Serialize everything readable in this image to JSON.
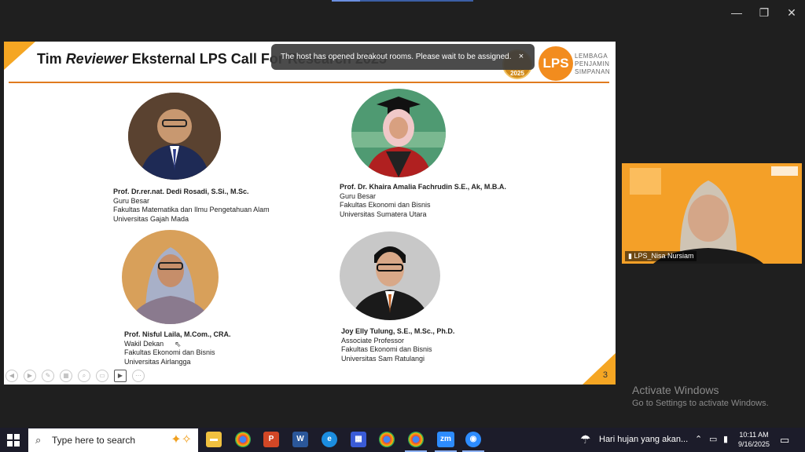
{
  "slide": {
    "title_pre": "Tim ",
    "title_italic": "Reviewer",
    "title_post": " Eksternal LPS Call For Research 2025",
    "page_number": "3",
    "badge_text": "2025",
    "logo": {
      "mark": "LPS",
      "line1": "LEMBAGA",
      "line2": "PENJAMIN",
      "line3": "SIMPANAN"
    },
    "people": [
      {
        "name": "Prof. Dr.rer.nat. Dedi Rosadi, S.Si., M.Sc.",
        "position": "Guru Besar",
        "faculty": "Fakultas Matematika dan Ilmu Pengetahuan Alam",
        "university": "Universitas Gajah Mada"
      },
      {
        "name": "Prof. Dr. Khaira Amalia Fachrudin S.E., Ak, M.B.A.",
        "position": "Guru Besar",
        "faculty": "Fakultas Ekonomi dan Bisnis",
        "university": "Universitas Sumatera Utara"
      },
      {
        "name": "Prof. Nisful Laila, M.Com., CRA.",
        "position": "Wakil Dekan",
        "faculty": "Fakultas Ekonomi dan Bisnis",
        "university": "Universitas Airlangga"
      },
      {
        "name": "Joy Elly Tulung, S.E., M.Sc., Ph.D.",
        "position": "Associate Professor",
        "faculty": "Fakultas Ekonomi dan Bisnis",
        "university": "Universitas Sam Ratulangi"
      }
    ]
  },
  "toast": {
    "message": "The host has opened breakout rooms. Please wait to be assigned.",
    "close": "×"
  },
  "video": {
    "participant": "LPS_Nisa Nursiam"
  },
  "watermark": {
    "line1": "Activate Windows",
    "line2": "Go to Settings to activate Windows."
  },
  "window_controls": {
    "minimize": "—",
    "restore": "❐",
    "close": "✕"
  },
  "taskbar": {
    "search_placeholder": "Type here to search",
    "weather": "Hari hujan yang akan...",
    "time": "10:11 AM",
    "date": "9/16/2025",
    "apps": [
      "file-explorer",
      "chrome",
      "powerpoint",
      "word",
      "edge",
      "app-grid",
      "chrome",
      "chrome",
      "zoom",
      "zoom-meeting"
    ]
  }
}
